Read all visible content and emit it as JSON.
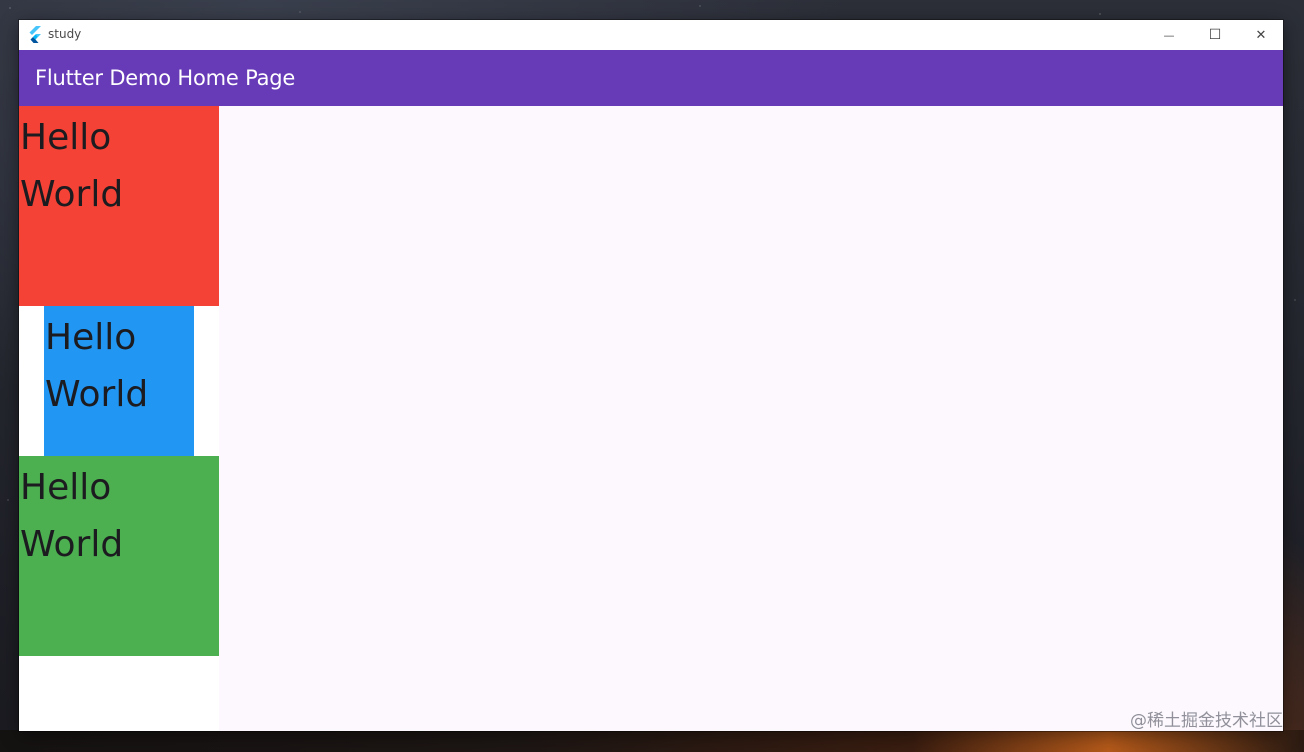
{
  "window": {
    "title": "study",
    "buttons": {
      "minimize": "—",
      "maximize": "☐",
      "close": "✕"
    }
  },
  "appbar": {
    "title": "Flutter Demo Home Page",
    "color": "#673ab7"
  },
  "boxes": [
    {
      "text": "Hello World",
      "color": "#f44336"
    },
    {
      "text": "Hello World",
      "color": "#2196f3"
    },
    {
      "text": "Hello World",
      "color": "#4caf50"
    }
  ],
  "watermark": "@稀土掘金技术社区",
  "icons": {
    "app": "flutter-logo-icon",
    "minimize": "minimize-icon",
    "maximize": "maximize-icon",
    "close": "close-icon"
  }
}
